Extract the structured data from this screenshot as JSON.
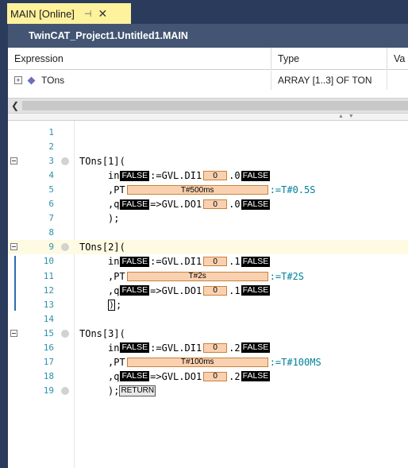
{
  "tab": {
    "title": "MAIN [Online]",
    "pin_glyph": "⊣",
    "close_glyph": "✕"
  },
  "titlebar": {
    "path": "TwinCAT_Project1.Untitled1.MAIN"
  },
  "declaration": {
    "columns": [
      "Expression",
      "Type",
      "Va"
    ],
    "rows": [
      {
        "expand": "+",
        "expression": "TOns",
        "type": "ARRAY [1..3] OF TON"
      }
    ]
  },
  "colors": {
    "tab_accent": "#fff29d",
    "title_bg": "#435573",
    "frame": "#2b3b5c",
    "online_value_bg": "#000000",
    "watch_box_bg": "#fad1b0",
    "line_number": "#2b91af",
    "literal": "#00809a"
  },
  "code": {
    "lines": [
      {
        "n": "1"
      },
      {
        "n": "2"
      },
      {
        "n": "3",
        "text": "TOns[1]("
      },
      {
        "n": "4",
        "pre": "in",
        "badge1": "FALSE",
        "mid": ":=GVL.DI1",
        "box": "0",
        "post": ".0",
        "badge2": "FALSE"
      },
      {
        "n": "5",
        "pre": ",PT",
        "box": "T#500ms",
        "tail": ":=T#0.5S"
      },
      {
        "n": "6",
        "pre": ",q",
        "badge1": "FALSE",
        "mid": "=>GVL.DO1",
        "box": "0",
        "post": ".0",
        "badge2": "FALSE"
      },
      {
        "n": "7",
        "text": ");"
      },
      {
        "n": "8"
      },
      {
        "n": "9",
        "text": "TOns[2]("
      },
      {
        "n": "10",
        "pre": "in",
        "badge1": "FALSE",
        "mid": ":=GVL.DI1",
        "box": "0",
        "post": ".1",
        "badge2": "FALSE"
      },
      {
        "n": "11",
        "pre": ",PT",
        "box": "T#2s",
        "tail": ":=T#2S"
      },
      {
        "n": "12",
        "pre": ",q",
        "badge1": "FALSE",
        "mid": "=>GVL.DO1",
        "box": "0",
        "post": ".1",
        "badge2": "FALSE"
      },
      {
        "n": "13",
        "cursor": ")",
        "text": ";"
      },
      {
        "n": "14"
      },
      {
        "n": "15",
        "text": "TOns[3]("
      },
      {
        "n": "16",
        "pre": "in",
        "badge1": "FALSE",
        "mid": ":=GVL.DI1",
        "box": "0",
        "post": ".2",
        "badge2": "FALSE"
      },
      {
        "n": "17",
        "pre": ",PT",
        "box": "T#100ms",
        "tail": ":=T#100MS"
      },
      {
        "n": "18",
        "pre": ",q",
        "badge1": "FALSE",
        "mid": "=>GVL.DO1",
        "box": "0",
        "post": ".2",
        "badge2": "FALSE"
      },
      {
        "n": "19",
        "text": ");",
        "ret": "RETURN"
      }
    ]
  }
}
